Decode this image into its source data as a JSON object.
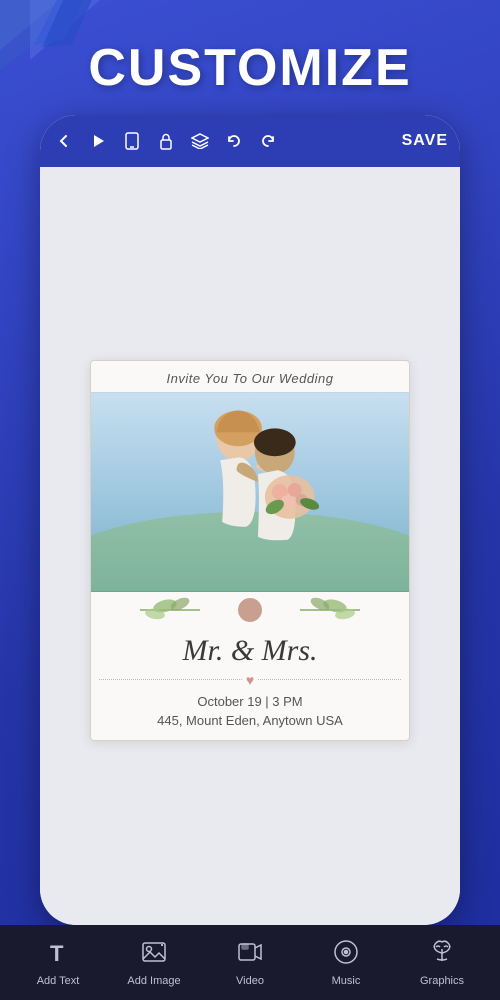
{
  "title": "CUSTOMIZE",
  "toolbar": {
    "save_label": "SAVE",
    "back_icon": "❮",
    "play_icon": "▶",
    "device_icon": "☐",
    "lock_icon": "🔓",
    "layers_icon": "❖",
    "undo_icon": "↺",
    "redo_icon": "↻"
  },
  "card": {
    "header_text": "Invite You To Our Wedding",
    "title": "Mr. & Mrs.",
    "date": "October 19 | 3 PM",
    "address": "445, Mount Eden, Anytown USA"
  },
  "bottom_bar": {
    "items": [
      {
        "label": "Add Text",
        "icon": "T"
      },
      {
        "label": "Add Image",
        "icon": "🖼"
      },
      {
        "label": "Video",
        "icon": "📹"
      },
      {
        "label": "Music",
        "icon": "🎵"
      },
      {
        "label": "Graphics",
        "icon": "🌿"
      }
    ]
  },
  "colors": {
    "background": "#2d3db4",
    "toolbar": "#2d3db4",
    "bottom_bar": "#1a1a2e"
  }
}
